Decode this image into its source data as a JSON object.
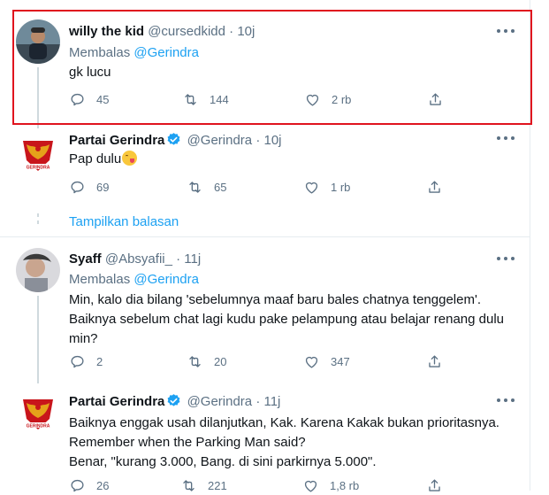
{
  "tweets": [
    {
      "name": "willy the kid",
      "handle": "@cursedkidd",
      "time": "· 10j",
      "reply_prefix": "Membalas",
      "reply_mention": "@Gerindra",
      "text": "gk lucu",
      "replies": "45",
      "retweets": "144",
      "likes": "2 rb",
      "avatar_icon": "user-photo-icon"
    },
    {
      "name": "Partai Gerindra",
      "handle": "@Gerindra",
      "time": "· 10j",
      "text": "Pap dulu",
      "emoji": "savoring-face-emoji",
      "replies": "69",
      "retweets": "65",
      "likes": "1 rb",
      "avatar_icon": "gerindra-garuda-logo-icon",
      "show_replies": "Tampilkan balasan"
    },
    {
      "name": "Syaff",
      "handle": "@Absyafii_",
      "time": "· 11j",
      "reply_prefix": "Membalas",
      "reply_mention": "@Gerindra",
      "lines": [
        "Min, kalo dia bilang 'sebelumnya maaf baru bales chatnya tenggelem'.",
        "Baiknya sebelum chat lagi kudu pake pelampung atau belajar renang dulu",
        "min?"
      ],
      "replies": "2",
      "retweets": "20",
      "likes": "347",
      "avatar_icon": "user-photo-icon"
    },
    {
      "name": "Partai Gerindra",
      "handle": "@Gerindra",
      "time": "· 11j",
      "lines": [
        "Baiknya enggak usah dilanjutkan, Kak. Karena Kakak bukan prioritasnya.",
        "Remember when the Parking Man said?",
        "Benar, \"kurang 3.000, Bang. di sini parkirnya 5.000\"."
      ],
      "replies": "26",
      "retweets": "221",
      "likes": "1,8 rb",
      "avatar_icon": "gerindra-garuda-logo-icon"
    }
  ],
  "colors": {
    "accent": "#1da1f2",
    "muted": "#5b7083",
    "highlight": "#e0141e",
    "gerindra_red": "#c8151b",
    "gerindra_gold": "#e5a21a"
  }
}
